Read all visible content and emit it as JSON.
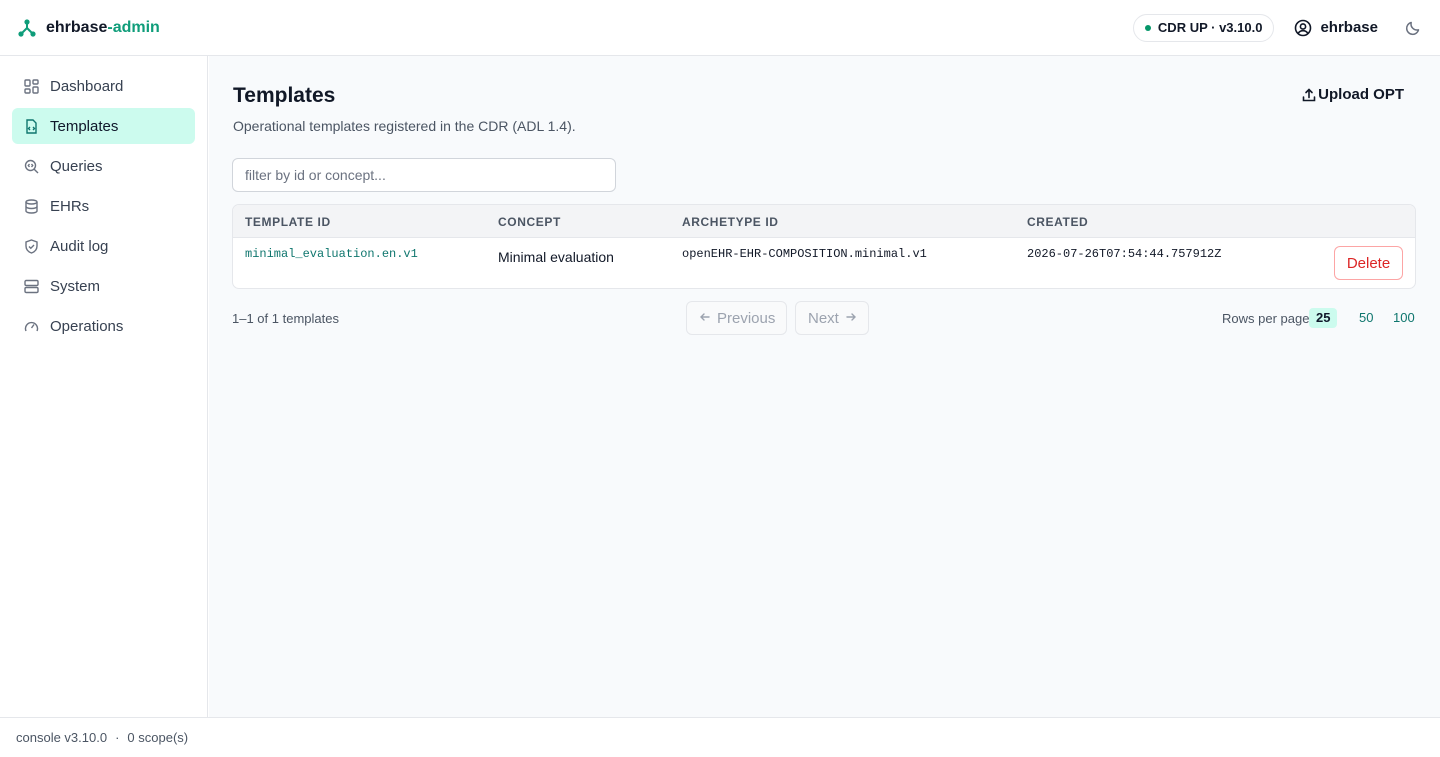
{
  "header": {
    "brand_main": "ehrbase",
    "brand_accent": "-admin",
    "status": "CDR UP · v3.10.0",
    "user": "ehrbase"
  },
  "sidebar": {
    "items": [
      {
        "label": "Dashboard",
        "icon": "grid-icon",
        "active": false
      },
      {
        "label": "Templates",
        "icon": "file-code-icon",
        "active": true
      },
      {
        "label": "Queries",
        "icon": "search-code-icon",
        "active": false
      },
      {
        "label": "EHRs",
        "icon": "database-icon",
        "active": false
      },
      {
        "label": "Audit log",
        "icon": "shield-check-icon",
        "active": false
      },
      {
        "label": "System",
        "icon": "server-icon",
        "active": false
      },
      {
        "label": "Operations",
        "icon": "gauge-icon",
        "active": false
      }
    ]
  },
  "page": {
    "title": "Templates",
    "subtitle": "Operational templates registered in the CDR (ADL 1.4).",
    "upload_label": "Upload OPT",
    "filter_placeholder": "filter by id or concept..."
  },
  "table": {
    "columns": [
      "TEMPLATE ID",
      "CONCEPT",
      "ARCHETYPE ID",
      "CREATED"
    ],
    "rows": [
      {
        "template_id": "minimal_evaluation.en.v1",
        "concept": "Minimal evaluation",
        "archetype_id": "openEHR-EHR-COMPOSITION.minimal.v1",
        "created": "2026-07-26T07:54:44.757912Z",
        "action": "Delete"
      }
    ]
  },
  "pagination": {
    "info": "1–1 of 1 templates",
    "previous": "Previous",
    "next": "Next",
    "rows_label": "Rows per page",
    "rows_options": [
      "25",
      "50",
      "100"
    ],
    "rows_selected": "25"
  },
  "footer": {
    "version": "console v3.10.0",
    "sep": "·",
    "scopes": "0 scope(s)"
  },
  "colors": {
    "accent": "#0f9d7a",
    "active_bg": "#ccfbee",
    "danger": "#dc2626"
  }
}
